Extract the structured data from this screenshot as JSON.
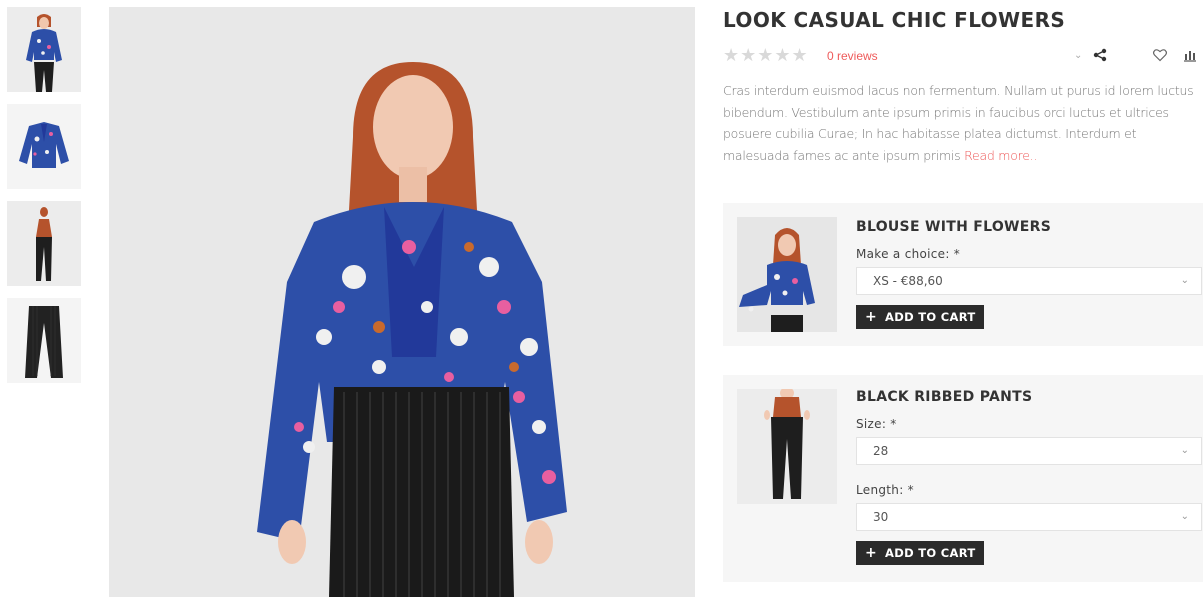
{
  "product": {
    "title": "LOOK CASUAL CHIC FLOWERS",
    "stars": "★★★★★",
    "rating": 0,
    "reviews_label": "0 reviews",
    "description": "Cras interdum euismod lacus non fermentum. Nullam ut purus id lorem luctus bibendum. Vestibulum ante ipsum primis in faucibus orci luctus et ultrices posuere cubilia Curae; In hac habitasse platea dictumst. Interdum et malesuada fames ac ante ipsum primis",
    "read_more": "Read more..",
    "accent_color": "#ee5a5a"
  },
  "items": [
    {
      "title": "BLOUSE WITH FLOWERS",
      "options": [
        {
          "label": "Make a choice: *",
          "selected": "XS - €88,60"
        }
      ],
      "add_label": "ADD TO CART"
    },
    {
      "title": "BLACK RIBBED PANTS",
      "options": [
        {
          "label": "Size: *",
          "selected": "28"
        },
        {
          "label": "Length: *",
          "selected": "30"
        }
      ],
      "add_label": "ADD TO CART"
    }
  ],
  "icons": [
    "share-icon",
    "heart-icon",
    "compare-icon",
    "chevron-down-icon",
    "plus-icon",
    "star-icon"
  ]
}
